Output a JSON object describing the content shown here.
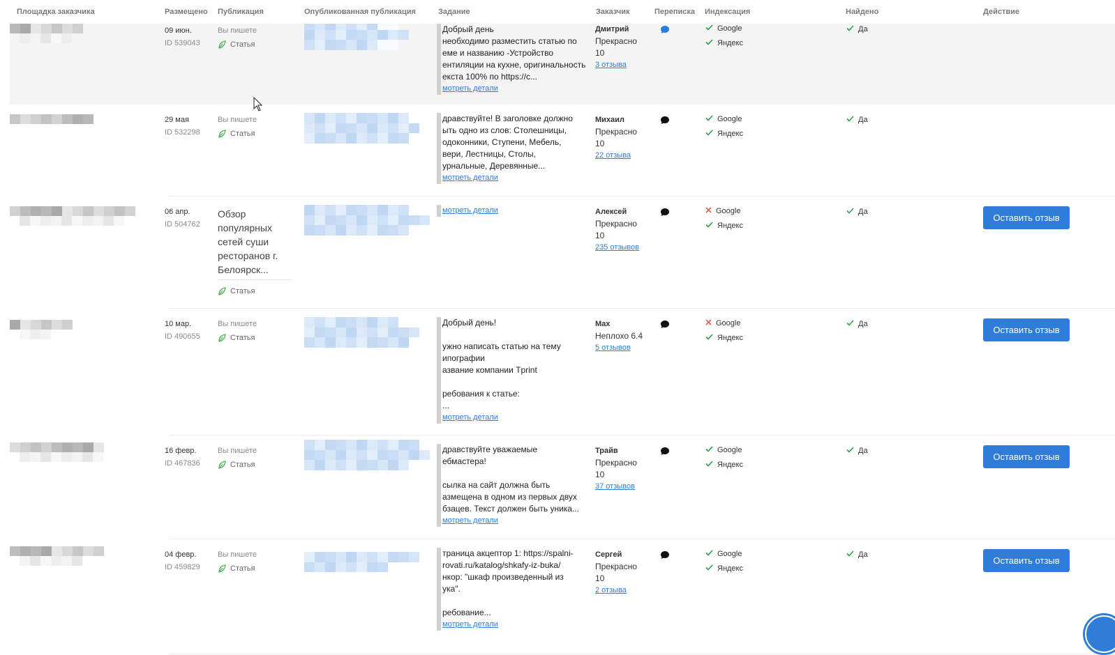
{
  "header": {
    "col_site": "Площадка заказчика",
    "col_placed": "Размещено",
    "col_pub": "Публикация",
    "col_published": "Опубликованная публикация",
    "col_task": "Задание",
    "col_customer": "Заказчик",
    "col_chat": "Переписка",
    "col_index": "Индексация",
    "col_found": "Найдено",
    "col_action": "Действие"
  },
  "common": {
    "google": "Google",
    "yandex": "Яндекс",
    "found_yes": "Да",
    "article": "Статья",
    "more": "мотреть детали",
    "action_button": "Оставить отзыв"
  },
  "colors": {
    "accent": "#2f7dd9",
    "check": "#2e9e4f",
    "cross": "#e04a3f",
    "leaf": "#4caf50"
  },
  "rows": [
    {
      "date": "09 июн.",
      "id": "ID 539043",
      "writer": "Вы пишете",
      "pub_title": "",
      "task": "Добрый день\nнеобходимо разместить статью по\nеме и названию -Устройство\nентиляции на кухне, оригинальность\nекста 100% по https://с...",
      "customer_name": "Дмитрий",
      "rating_word": "Прекрасно",
      "rating_value": "10",
      "reviews": "3 отзыва",
      "chat_icon": "chat-blue-icon",
      "google": "check",
      "yandex": "check",
      "found": "Да",
      "action": ""
    },
    {
      "date": "29 мая",
      "id": "ID 532298",
      "writer": "Вы пишете",
      "pub_title": "",
      "task": "дравствуйте! В заголовке должно\nыть одно из слов: Столешницы,\nодоконники, Ступени, Мебель,\nвери, Лестницы, Столы,\nурнальные, Деревянные...",
      "customer_name": "Михаил",
      "rating_word": "Прекрасно",
      "rating_value": "10",
      "reviews": "22 отзыва",
      "chat_icon": "chat-black-icon",
      "google": "check",
      "yandex": "check",
      "found": "Да",
      "action": ""
    },
    {
      "date": "06 апр.",
      "id": "ID 504762",
      "writer": "",
      "pub_title": "Обзор популярных сетей суши ресторанов г. Белоярск...",
      "task": "",
      "customer_name": "Алексей",
      "rating_word": "Прекрасно",
      "rating_value": "10",
      "reviews": "235 отзывов",
      "chat_icon": "chat-black-icon",
      "google": "cross",
      "yandex": "check",
      "found": "Да",
      "action": "Оставить отзыв"
    },
    {
      "date": "10 мар.",
      "id": "ID 490655",
      "writer": "Вы пишете",
      "pub_title": "",
      "task": "Добрый день!\n\nужно написать статью на тему\nипографии\nазвание компании Tprint\n\nребования к статье:\n...",
      "customer_name": "Max",
      "rating_word": "Неплохо 6.4",
      "rating_value": "",
      "reviews": "5 отзывов",
      "chat_icon": "chat-black-icon",
      "google": "cross",
      "yandex": "check",
      "found": "Да",
      "action": "Оставить отзыв"
    },
    {
      "date": "16 февр.",
      "id": "ID 467836",
      "writer": "Вы пишете",
      "pub_title": "",
      "task": "дравствуйте уважаемые\nебмастера!\n\nсылка на сайт должна быть\nазмещена в одном из первых двух\nбзацев. Текст должен быть уника...",
      "customer_name": "Трайв",
      "rating_word": "Прекрасно",
      "rating_value": "10",
      "reviews": "37 отзывов",
      "chat_icon": "chat-black-icon",
      "google": "check",
      "yandex": "check",
      "found": "Да",
      "action": "Оставить отзыв"
    },
    {
      "date": "04 февр.",
      "id": "ID 459829",
      "writer": "Вы пишете",
      "pub_title": "",
      "task": "траница акцептор 1: https://spalni-\nrovati.ru/katalog/shkafy-iz-buka/\nнкор: \"шкаф произведенный из\nука\".\n\nребование...",
      "customer_name": "Сергей",
      "rating_word": "Прекрасно",
      "rating_value": "10",
      "reviews": "2 отзыва",
      "chat_icon": "chat-black-icon",
      "google": "check",
      "yandex": "check",
      "found": "Да",
      "action": "Оставить отзыв"
    }
  ]
}
